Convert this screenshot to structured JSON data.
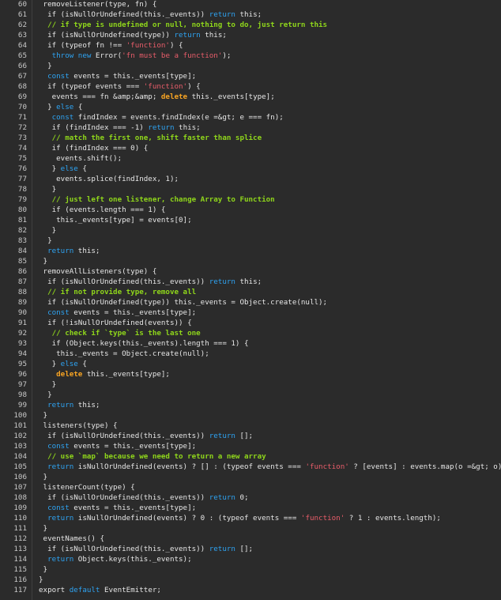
{
  "colors": {
    "background": "#2b2b2b",
    "plain": "#e6e6e6",
    "keyword": "#2ea3f2",
    "string": "#e95d6a",
    "comment": "#8fd61b",
    "warn_keyword": "#f6a323",
    "line_number": "#c8c8c8"
  },
  "lines": [
    {
      "n": "60",
      "tokens": [
        [
          "p",
          " removeListener(type, fn) {"
        ]
      ]
    },
    {
      "n": "61",
      "tokens": [
        [
          "p",
          "  if (isNullOrUndefined(this._events)) "
        ],
        [
          "k",
          "return"
        ],
        [
          "p",
          " this;"
        ]
      ]
    },
    {
      "n": "62",
      "tokens": [
        [
          "c",
          "  // if type is undefined or null, nothing to do, just return this"
        ]
      ]
    },
    {
      "n": "63",
      "tokens": [
        [
          "p",
          "  if (isNullOrUndefined(type)) "
        ],
        [
          "k",
          "return"
        ],
        [
          "p",
          " this;"
        ]
      ]
    },
    {
      "n": "64",
      "tokens": [
        [
          "p",
          "  if (typeof fn !== "
        ],
        [
          "s",
          "'function'"
        ],
        [
          "p",
          ") {"
        ]
      ]
    },
    {
      "n": "65",
      "tokens": [
        [
          "k",
          "   throw new"
        ],
        [
          "p",
          " Error("
        ],
        [
          "s",
          "'fn must be a function'"
        ],
        [
          "p",
          ");"
        ]
      ]
    },
    {
      "n": "66",
      "tokens": [
        [
          "p",
          "  }"
        ]
      ]
    },
    {
      "n": "67",
      "tokens": [
        [
          "k",
          "  const"
        ],
        [
          "p",
          " events = this._events[type];"
        ]
      ]
    },
    {
      "n": "68",
      "tokens": [
        [
          "p",
          "  if (typeof events === "
        ],
        [
          "s",
          "'function'"
        ],
        [
          "p",
          ") {"
        ]
      ]
    },
    {
      "n": "69",
      "tokens": [
        [
          "p",
          "   events === fn &amp;&amp; "
        ],
        [
          "w",
          "delete"
        ],
        [
          "p",
          " this._events[type];"
        ]
      ]
    },
    {
      "n": "70",
      "tokens": [
        [
          "p",
          "  } "
        ],
        [
          "k",
          "else"
        ],
        [
          "p",
          " {"
        ]
      ]
    },
    {
      "n": "71",
      "tokens": [
        [
          "k",
          "   const"
        ],
        [
          "p",
          " findIndex = events.findIndex(e =&gt; e === fn);"
        ]
      ]
    },
    {
      "n": "72",
      "tokens": [
        [
          "p",
          "   if (findIndex === -1) "
        ],
        [
          "k",
          "return"
        ],
        [
          "p",
          " this;"
        ]
      ]
    },
    {
      "n": "73",
      "tokens": [
        [
          "c",
          "   // match the first one, shift faster than splice"
        ]
      ]
    },
    {
      "n": "74",
      "tokens": [
        [
          "p",
          "   if (findIndex === 0) {"
        ]
      ]
    },
    {
      "n": "75",
      "tokens": [
        [
          "p",
          "    events.shift();"
        ]
      ]
    },
    {
      "n": "76",
      "tokens": [
        [
          "p",
          "   } "
        ],
        [
          "k",
          "else"
        ],
        [
          "p",
          " {"
        ]
      ]
    },
    {
      "n": "77",
      "tokens": [
        [
          "p",
          "    events.splice(findIndex, 1);"
        ]
      ]
    },
    {
      "n": "78",
      "tokens": [
        [
          "p",
          "   }"
        ]
      ]
    },
    {
      "n": "79",
      "tokens": [
        [
          "c",
          "   // just left one listener, change Array to Function"
        ]
      ]
    },
    {
      "n": "80",
      "tokens": [
        [
          "p",
          "   if (events.length === 1) {"
        ]
      ]
    },
    {
      "n": "81",
      "tokens": [
        [
          "p",
          "    this._events[type] = events[0];"
        ]
      ]
    },
    {
      "n": "82",
      "tokens": [
        [
          "p",
          "   }"
        ]
      ]
    },
    {
      "n": "83",
      "tokens": [
        [
          "p",
          "  }"
        ]
      ]
    },
    {
      "n": "84",
      "tokens": [
        [
          "k",
          "  return"
        ],
        [
          "p",
          " this;"
        ]
      ]
    },
    {
      "n": "85",
      "tokens": [
        [
          "p",
          " }"
        ]
      ]
    },
    {
      "n": "86",
      "tokens": [
        [
          "p",
          " removeAllListeners(type) {"
        ]
      ]
    },
    {
      "n": "87",
      "tokens": [
        [
          "p",
          "  if (isNullOrUndefined(this._events)) "
        ],
        [
          "k",
          "return"
        ],
        [
          "p",
          " this;"
        ]
      ]
    },
    {
      "n": "88",
      "tokens": [
        [
          "c",
          "  // if not provide type, remove all"
        ]
      ]
    },
    {
      "n": "89",
      "tokens": [
        [
          "p",
          "  if (isNullOrUndefined(type)) this._events = Object.create(null);"
        ]
      ]
    },
    {
      "n": "90",
      "tokens": [
        [
          "k",
          "  const"
        ],
        [
          "p",
          " events = this._events[type];"
        ]
      ]
    },
    {
      "n": "91",
      "tokens": [
        [
          "p",
          "  if (!isNullOrUndefined(events)) {"
        ]
      ]
    },
    {
      "n": "92",
      "tokens": [
        [
          "c",
          "   // check if `type` is the last one"
        ]
      ]
    },
    {
      "n": "93",
      "tokens": [
        [
          "p",
          "   if (Object.keys(this._events).length === 1) {"
        ]
      ]
    },
    {
      "n": "94",
      "tokens": [
        [
          "p",
          "    this._events = Object.create(null);"
        ]
      ]
    },
    {
      "n": "95",
      "tokens": [
        [
          "p",
          "   } "
        ],
        [
          "k",
          "else"
        ],
        [
          "p",
          " {"
        ]
      ]
    },
    {
      "n": "96",
      "tokens": [
        [
          "w",
          "    delete"
        ],
        [
          "p",
          " this._events[type];"
        ]
      ]
    },
    {
      "n": "97",
      "tokens": [
        [
          "p",
          "   }"
        ]
      ]
    },
    {
      "n": "98",
      "tokens": [
        [
          "p",
          "  }"
        ]
      ]
    },
    {
      "n": "99",
      "tokens": [
        [
          "k",
          "  return"
        ],
        [
          "p",
          " this;"
        ]
      ]
    },
    {
      "n": "100",
      "tokens": [
        [
          "p",
          " }"
        ]
      ]
    },
    {
      "n": "101",
      "tokens": [
        [
          "p",
          " listeners(type) {"
        ]
      ]
    },
    {
      "n": "102",
      "tokens": [
        [
          "p",
          "  if (isNullOrUndefined(this._events)) "
        ],
        [
          "k",
          "return"
        ],
        [
          "p",
          " [];"
        ]
      ]
    },
    {
      "n": "103",
      "tokens": [
        [
          "k",
          "  const"
        ],
        [
          "p",
          " events = this._events[type];"
        ]
      ]
    },
    {
      "n": "104",
      "tokens": [
        [
          "c",
          "  // use `map` because we need to return a new array"
        ]
      ]
    },
    {
      "n": "105",
      "tokens": [
        [
          "k",
          "  return"
        ],
        [
          "p",
          " isNullOrUndefined(events) ? [] : (typeof events === "
        ],
        [
          "s",
          "'function'"
        ],
        [
          "p",
          " ? [events] : events.map(o =&gt; o));"
        ]
      ]
    },
    {
      "n": "106",
      "tokens": [
        [
          "p",
          " }"
        ]
      ]
    },
    {
      "n": "107",
      "tokens": [
        [
          "p",
          " listenerCount(type) {"
        ]
      ]
    },
    {
      "n": "108",
      "tokens": [
        [
          "p",
          "  if (isNullOrUndefined(this._events)) "
        ],
        [
          "k",
          "return"
        ],
        [
          "p",
          " 0;"
        ]
      ]
    },
    {
      "n": "109",
      "tokens": [
        [
          "k",
          "  const"
        ],
        [
          "p",
          " events = this._events[type];"
        ]
      ]
    },
    {
      "n": "110",
      "tokens": [
        [
          "k",
          "  return"
        ],
        [
          "p",
          " isNullOrUndefined(events) ? 0 : (typeof events === "
        ],
        [
          "s",
          "'function'"
        ],
        [
          "p",
          " ? 1 : events.length);"
        ]
      ]
    },
    {
      "n": "111",
      "tokens": [
        [
          "p",
          " }"
        ]
      ]
    },
    {
      "n": "112",
      "tokens": [
        [
          "p",
          " eventNames() {"
        ]
      ]
    },
    {
      "n": "113",
      "tokens": [
        [
          "p",
          "  if (isNullOrUndefined(this._events)) "
        ],
        [
          "k",
          "return"
        ],
        [
          "p",
          " [];"
        ]
      ]
    },
    {
      "n": "114",
      "tokens": [
        [
          "k",
          "  return"
        ],
        [
          "p",
          " Object.keys(this._events);"
        ]
      ]
    },
    {
      "n": "115",
      "tokens": [
        [
          "p",
          " }"
        ]
      ]
    },
    {
      "n": "116",
      "tokens": [
        [
          "p",
          "}"
        ]
      ]
    },
    {
      "n": "117",
      "tokens": [
        [
          "p",
          "export "
        ],
        [
          "k",
          "default"
        ],
        [
          "p",
          " EventEmitter;"
        ]
      ]
    }
  ]
}
